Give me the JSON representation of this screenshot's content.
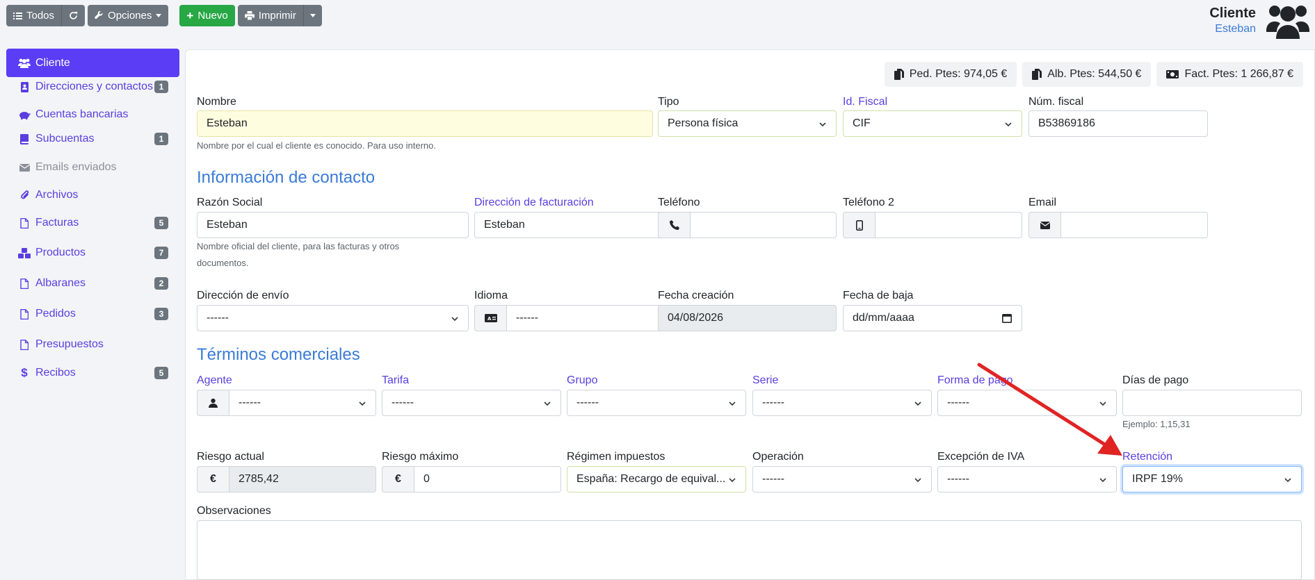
{
  "toolbar": {
    "all_label": "Todos",
    "options_label": "Opciones",
    "new_label": "Nuevo",
    "print_label": "Imprimir"
  },
  "header": {
    "title": "Cliente",
    "subtitle": "Esteban"
  },
  "sidebar": {
    "items": [
      {
        "label": "Cliente",
        "icon": "users-icon",
        "badge": ""
      },
      {
        "label": "Direcciones y contactos",
        "icon": "address-book-icon",
        "badge": "1"
      },
      {
        "label": "Cuentas bancarias",
        "icon": "piggy-bank-icon",
        "badge": ""
      },
      {
        "label": "Subcuentas",
        "icon": "book-icon",
        "badge": "1"
      },
      {
        "label": "Emails enviados",
        "icon": "envelope-icon",
        "badge": ""
      },
      {
        "label": "Archivos",
        "icon": "paperclip-icon",
        "badge": ""
      },
      {
        "label": "Facturas",
        "icon": "file-icon",
        "badge": "5"
      },
      {
        "label": "Productos",
        "icon": "cubes-icon",
        "badge": "7"
      },
      {
        "label": "Albaranes",
        "icon": "file-icon",
        "badge": "2"
      },
      {
        "label": "Pedidos",
        "icon": "file-icon",
        "badge": "3"
      },
      {
        "label": "Presupuestos",
        "icon": "file-icon",
        "badge": ""
      },
      {
        "label": "Recibos",
        "icon": "dollar-icon",
        "badge": "5"
      }
    ]
  },
  "pills": {
    "orders": "Ped. Ptes: 974,05 €",
    "delivery": "Alb. Ptes: 544,50 €",
    "invoices": "Fact. Ptes: 1 266,87 €"
  },
  "form": {
    "nombre_label": "Nombre",
    "nombre_value": "Esteban",
    "nombre_help": "Nombre por el cual el cliente es conocido. Para uso interno.",
    "tipo_label": "Tipo",
    "tipo_value": "Persona física",
    "idfiscal_label": "Id. Fiscal",
    "idfiscal_value": "CIF",
    "numfiscal_label": "Núm. fiscal",
    "numfiscal_value": "B53869186",
    "contact_section": "Información de contacto",
    "razon_label": "Razón Social",
    "razon_value": "Esteban",
    "razon_help_1": "Nombre oficial del cliente, para las facturas y otros",
    "razon_help_2": "documentos.",
    "dirfact_label": "Dirección de facturación",
    "dirfact_value": "Esteban",
    "telefono_label": "Teléfono",
    "telefono2_label": "Teléfono 2",
    "email_label": "Email",
    "direnvio_label": "Dirección de envío",
    "direnvio_value": "------",
    "idioma_label": "Idioma",
    "idioma_value": "------",
    "fechacre_label": "Fecha creación",
    "fechacre_value": "04/08/2026",
    "fechabaja_label": "Fecha de baja",
    "fechabaja_value": "dd/mm/aaaa",
    "terms_section": "Términos comerciales",
    "agente_label": "Agente",
    "agente_value": "------",
    "tarifa_label": "Tarifa",
    "tarifa_value": "------",
    "grupo_label": "Grupo",
    "grupo_value": "------",
    "serie_label": "Serie",
    "serie_value": "------",
    "formapago_label": "Forma de pago",
    "formapago_value": "------",
    "diaspago_label": "Días de pago",
    "diaspago_help": "Ejemplo: 1,15,31",
    "riesgoact_label": "Riesgo actual",
    "riesgoact_value": "2785,42",
    "riesgomax_label": "Riesgo máximo",
    "riesgomax_value": "0",
    "regimen_label": "Régimen impuestos",
    "regimen_value": "España: Recargo de equival...",
    "operacion_label": "Operación",
    "operacion_value": "------",
    "excepcion_label": "Excepción de IVA",
    "excepcion_value": "------",
    "retencion_label": "Retención",
    "retencion_value": "IRPF 19%",
    "observaciones_label": "Observaciones",
    "currency_symbol": "€"
  },
  "colors": {
    "accent": "#5b3df5",
    "link": "#5a3ee0",
    "section": "#3a7bd5",
    "arrow": "#e02424"
  }
}
